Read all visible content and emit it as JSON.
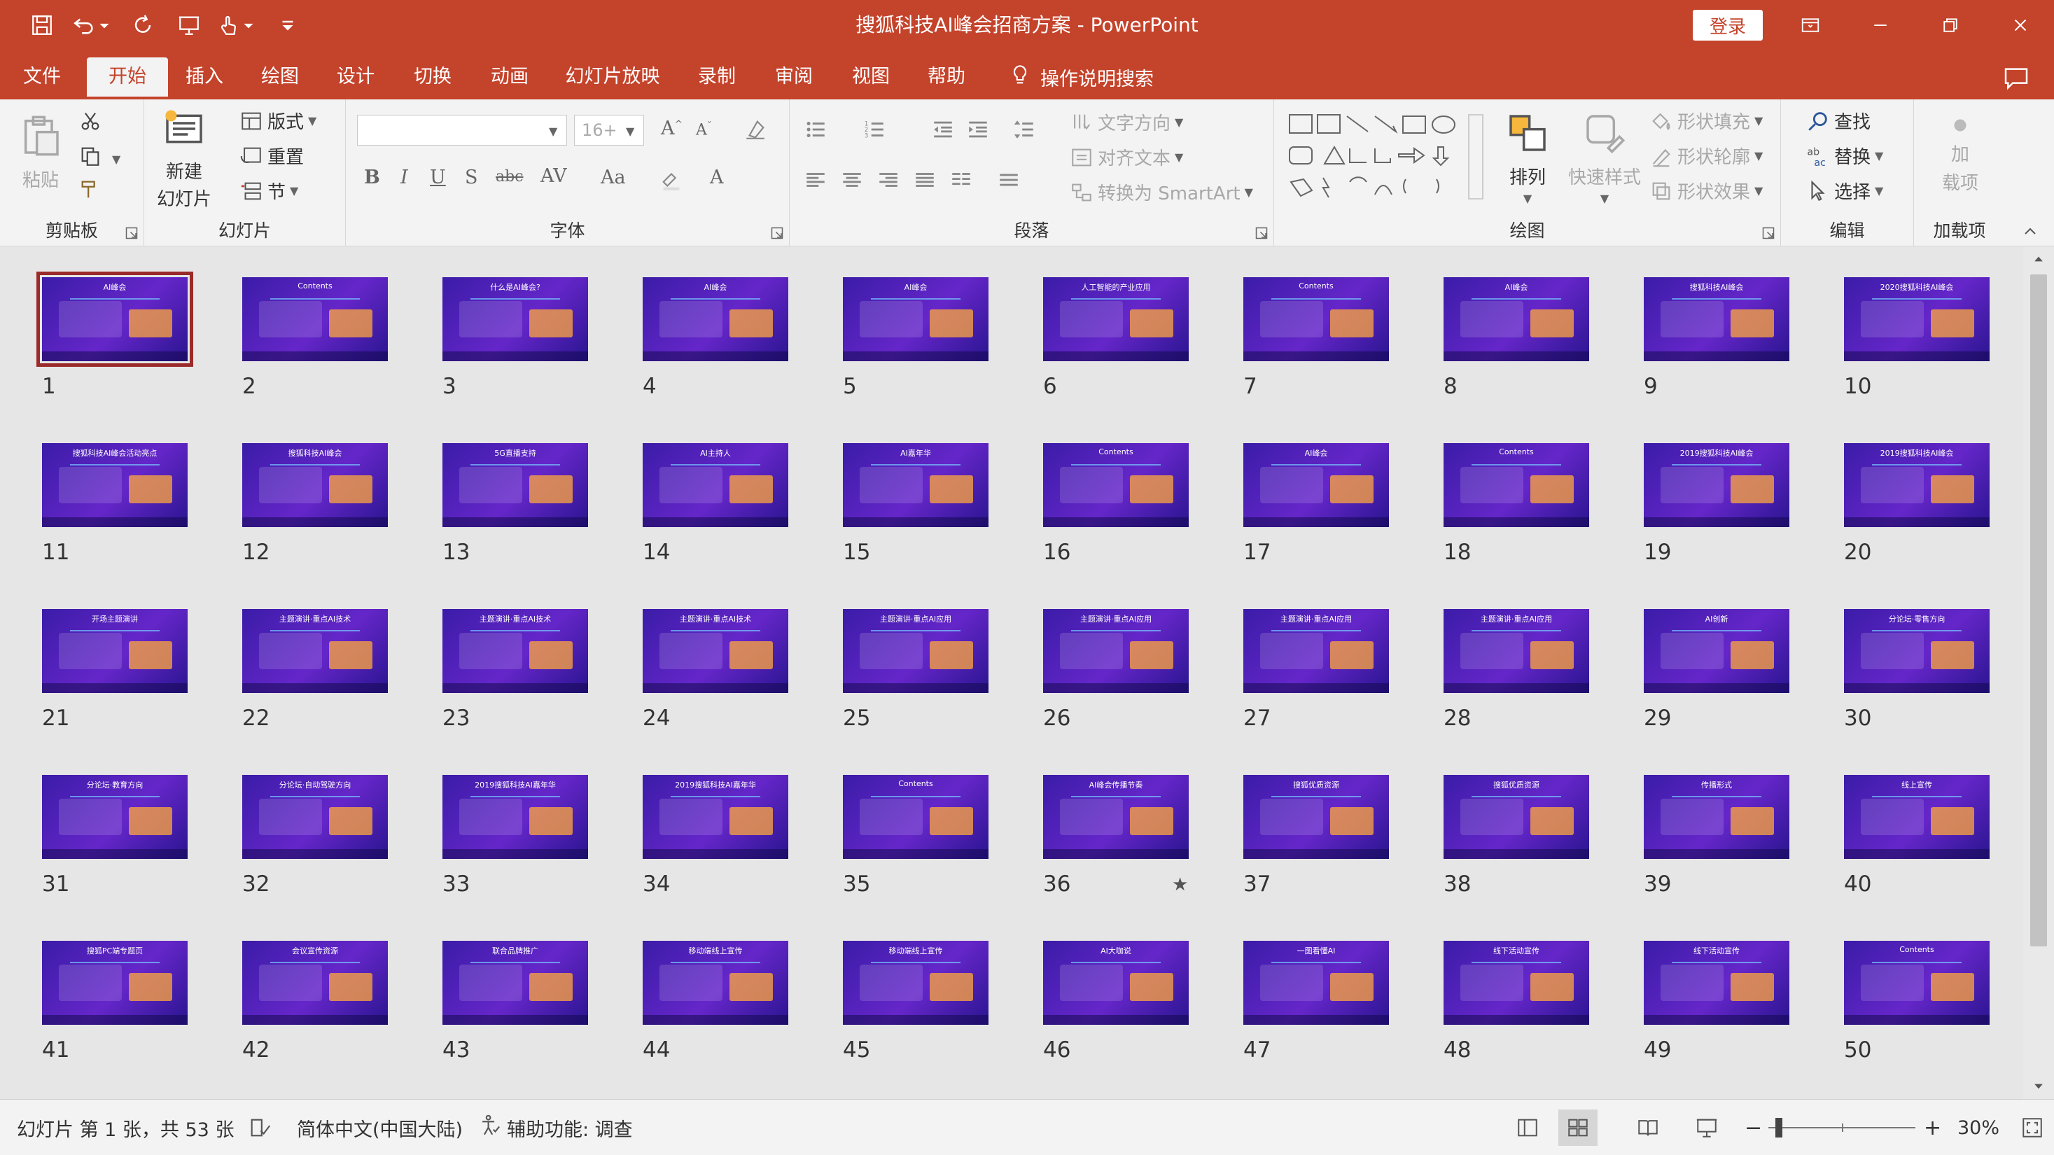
{
  "window": {
    "title": "搜狐科技AI峰会招商方案  -  PowerPoint",
    "login_label": "登录"
  },
  "tabs": [
    {
      "label": "文件"
    },
    {
      "label": "开始"
    },
    {
      "label": "插入"
    },
    {
      "label": "绘图"
    },
    {
      "label": "设计"
    },
    {
      "label": "切换"
    },
    {
      "label": "动画"
    },
    {
      "label": "幻灯片放映"
    },
    {
      "label": "录制"
    },
    {
      "label": "审阅"
    },
    {
      "label": "视图"
    },
    {
      "label": "帮助"
    }
  ],
  "active_tab": "开始",
  "tell_me": "操作说明搜索",
  "ribbon": {
    "clipboard": {
      "label": "剪贴板",
      "paste": "粘贴"
    },
    "slides": {
      "label": "幻灯片",
      "new_slide_1": "新建",
      "new_slide_2": "幻灯片",
      "layout": "版式",
      "reset": "重置",
      "section": "节"
    },
    "font": {
      "label": "字体",
      "size_placeholder": "16+"
    },
    "paragraph": {
      "label": "段落",
      "text_direction": "文字方向",
      "align_text": "对齐文本",
      "smartart": "转换为 SmartArt"
    },
    "drawing": {
      "label": "绘图",
      "arrange": "排列",
      "quick_styles": "快速样式",
      "shape_fill": "形状填充",
      "shape_outline": "形状轮廓",
      "shape_effects": "形状效果"
    },
    "editing": {
      "label": "编辑",
      "find": "查找",
      "replace": "替换",
      "select": "选择"
    },
    "addins": {
      "label": "加载项",
      "addins_1": "加",
      "addins_2": "载项"
    }
  },
  "slides": [
    {
      "n": "1",
      "title": "AI峰会"
    },
    {
      "n": "2",
      "title": "Contents"
    },
    {
      "n": "3",
      "title": "什么是AI峰会?"
    },
    {
      "n": "4",
      "title": "AI峰会"
    },
    {
      "n": "5",
      "title": "AI峰会"
    },
    {
      "n": "6",
      "title": "人工智能的产业应用"
    },
    {
      "n": "7",
      "title": "Contents"
    },
    {
      "n": "8",
      "title": "AI峰会"
    },
    {
      "n": "9",
      "title": "搜狐科技AI峰会"
    },
    {
      "n": "10",
      "title": "2020搜狐科技AI峰会"
    },
    {
      "n": "11",
      "title": "搜狐科技AI峰会活动亮点"
    },
    {
      "n": "12",
      "title": "搜狐科技AI峰会"
    },
    {
      "n": "13",
      "title": "5G直播支持"
    },
    {
      "n": "14",
      "title": "AI主持人"
    },
    {
      "n": "15",
      "title": "AI嘉年华"
    },
    {
      "n": "16",
      "title": "Contents"
    },
    {
      "n": "17",
      "title": "AI峰会"
    },
    {
      "n": "18",
      "title": "Contents"
    },
    {
      "n": "19",
      "title": "2019搜狐科技AI峰会"
    },
    {
      "n": "20",
      "title": "2019搜狐科技AI峰会"
    },
    {
      "n": "21",
      "title": "开场主题演讲"
    },
    {
      "n": "22",
      "title": "主题演讲·重点AI技术"
    },
    {
      "n": "23",
      "title": "主题演讲·重点AI技术"
    },
    {
      "n": "24",
      "title": "主题演讲·重点AI技术"
    },
    {
      "n": "25",
      "title": "主题演讲·重点AI应用"
    },
    {
      "n": "26",
      "title": "主题演讲·重点AI应用"
    },
    {
      "n": "27",
      "title": "主题演讲·重点AI应用"
    },
    {
      "n": "28",
      "title": "主题演讲·重点AI应用"
    },
    {
      "n": "29",
      "title": "AI创新"
    },
    {
      "n": "30",
      "title": "分论坛·零售方向"
    },
    {
      "n": "31",
      "title": "分论坛·教育方向"
    },
    {
      "n": "32",
      "title": "分论坛·自动驾驶方向"
    },
    {
      "n": "33",
      "title": "2019搜狐科技AI嘉年华"
    },
    {
      "n": "34",
      "title": "2019搜狐科技AI嘉年华"
    },
    {
      "n": "35",
      "title": "Contents"
    },
    {
      "n": "36",
      "title": "AI峰会传播节奏"
    },
    {
      "n": "37",
      "title": "搜狐优质资源"
    },
    {
      "n": "38",
      "title": "搜狐优质资源"
    },
    {
      "n": "39",
      "title": "传播形式"
    },
    {
      "n": "40",
      "title": "线上宣传"
    },
    {
      "n": "41",
      "title": "搜狐PC端专题页"
    },
    {
      "n": "42",
      "title": "会议宣传资源"
    },
    {
      "n": "43",
      "title": "联合品牌推广"
    },
    {
      "n": "44",
      "title": "移动端线上宣传"
    },
    {
      "n": "45",
      "title": "移动端线上宣传"
    },
    {
      "n": "46",
      "title": "AI大咖说"
    },
    {
      "n": "47",
      "title": "一图看懂AI"
    },
    {
      "n": "48",
      "title": "线下活动宣传"
    },
    {
      "n": "49",
      "title": "线下活动宣传"
    },
    {
      "n": "50",
      "title": "Contents"
    }
  ],
  "selected_slide": "1",
  "star_mark": "★",
  "status": {
    "slide_info": "幻灯片 第 1 张，共 53 张",
    "language": "简体中文(中国大陆)",
    "accessibility": "辅助功能: 调查",
    "zoom_minus": "−",
    "zoom_plus": "+",
    "zoom": "30%"
  },
  "colors": {
    "accent": "#c4432b",
    "selection_border": "#9b2a2a",
    "slide_bg": "#4a22b8"
  }
}
